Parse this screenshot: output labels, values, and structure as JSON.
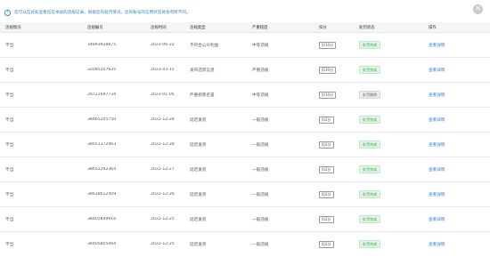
{
  "notice": {
    "text": "您可以在此处查看您在本站的违规记录。根据您的处罚情况，您的账号的信用状态将会有所不同。"
  },
  "close_label": "×",
  "table": {
    "headers": [
      "违规情况",
      "违规编号",
      "违规时间",
      "违规类型",
      "严重程度",
      "扣分",
      "处罚状态",
      "操作"
    ],
    "rows": [
      {
        "situation": "不当",
        "id": "34893928875",
        "date": "2023-06-22",
        "type": "不符合公众利益",
        "severity": "中等违规",
        "score": "扣10分",
        "status": "处罚完成",
        "status_kind": "green",
        "action": "查看详情"
      },
      {
        "situation": "不当",
        "id": "32095207635",
        "date": "2023-03-15",
        "type": "发布违禁信息",
        "severity": "严重违规",
        "score": "扣30分",
        "status": "处罚完成",
        "status_kind": "green",
        "action": "查看详情"
      },
      {
        "situation": "不当",
        "id": "28721697734",
        "date": "2023-01-05",
        "type": "严重损害名誉",
        "severity": "中等违规",
        "score": "扣10分",
        "status": "处罚撤销",
        "status_kind": "gray",
        "action": "查看详情"
      },
      {
        "situation": "不当",
        "id": "38465205750",
        "date": "2022-12-28",
        "type": "延迟发货",
        "severity": "一般违规",
        "score": "扣2分",
        "status": "处罚完成",
        "status_kind": "green",
        "action": "查看详情"
      },
      {
        "situation": "不当",
        "id": "38651372463",
        "date": "2022-12-28",
        "type": "延迟发货",
        "severity": "一般违规",
        "score": "扣2分",
        "status": "处罚完成",
        "status_kind": "green",
        "action": "查看详情"
      },
      {
        "situation": "不当",
        "id": "38652292364",
        "date": "2022-12-27",
        "type": "延迟发货",
        "severity": "一般违规",
        "score": "扣2分",
        "status": "处罚完成",
        "status_kind": "green",
        "action": "查看详情"
      },
      {
        "situation": "不当",
        "id": "38618612409",
        "date": "2022-12-26",
        "type": "延迟发货",
        "severity": "一般违规",
        "score": "扣2分",
        "status": "处罚完成",
        "status_kind": "green",
        "action": "查看详情"
      },
      {
        "situation": "不当",
        "id": "38405849916",
        "date": "2022-12-25",
        "type": "延迟发货",
        "severity": "一般违规",
        "score": "扣2分",
        "status": "处罚完成",
        "status_kind": "green",
        "action": "查看详情"
      },
      {
        "situation": "不当",
        "id": "38405805464",
        "date": "2022-12-25",
        "type": "延迟发货",
        "severity": "一般违规",
        "score": "扣2分",
        "status": "处罚完成",
        "status_kind": "green",
        "action": "查看详情"
      }
    ]
  },
  "colors": {
    "accent_link": "#2f7de1",
    "status_green": "#2f9e44",
    "notice_blue": "#3b82c4"
  },
  "icons": {
    "notice": "info-circle-icon",
    "close": "close-icon"
  }
}
